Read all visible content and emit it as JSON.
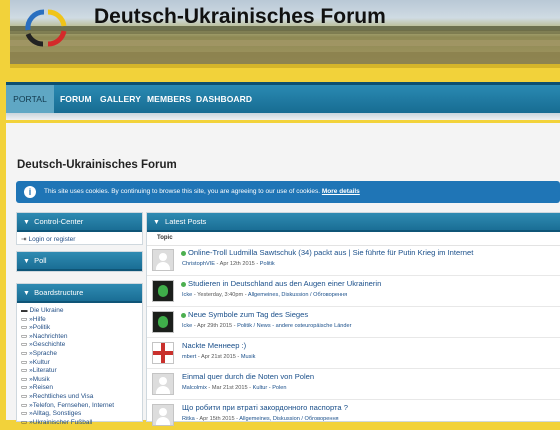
{
  "site": {
    "title": "Deutsch-Ukrainisches Forum"
  },
  "colors": {
    "page_bg": "#f2d23a",
    "nav": "#1f7aa5",
    "notice": "#1f75b6",
    "online": "#4caf50"
  },
  "nav": {
    "items": [
      "PORTAL",
      "FORUM",
      "GALLERY",
      "MEMBERS",
      "DASHBOARD"
    ]
  },
  "page": {
    "title": "Deutsch-Ukrainisches Forum"
  },
  "notice": {
    "text": "This site uses cookies. By continuing to browse this site, you are agreeing to our use of cookies.",
    "link": "More details",
    "icon": "info-icon"
  },
  "sidebar": {
    "control_center": {
      "title": "Control-Center",
      "login": "Login or register"
    },
    "poll": {
      "title": "Poll"
    },
    "boards": {
      "title": "Boardstructure",
      "items": [
        "Die Ukraine",
        "»Hilfe",
        "»Politik",
        "»Nachrichten",
        "»Geschichte",
        "»Sprache",
        "»Kultur",
        "»Literatur",
        "»Musik",
        "»Reisen",
        "»Rechtliches und Visa",
        "»Telefon, Fernsehen, Internet",
        "»Alltag, Sonstiges",
        "»Ukrainischer Fußball"
      ]
    }
  },
  "latest": {
    "title": "Latest Posts",
    "column": "Topic",
    "posts": [
      {
        "title": "Online-Troll Ludmilla Sawtschuk (34) packt aus | Sie führte für Putin Krieg im Internet",
        "user": "ChristophVIE",
        "date": "Apr 12th 2015",
        "category": "Politik",
        "avatar": "default"
      },
      {
        "title": "Studieren in Deutschland aus den Augen einer Ukrainerin",
        "user": "Icke",
        "date": "Yesterday, 3:40pm",
        "category": "Allgemeines, Diskussion / Обговорення",
        "avatar": "dark"
      },
      {
        "title": "Neue Symbole zum Tag des Sieges",
        "user": "Icke",
        "date": "Apr 29th 2015",
        "category": "Politik / News - andere osteuropäische Länder",
        "avatar": "dark"
      },
      {
        "title": "Nackte Меннеер :)",
        "user": "mbert",
        "date": "Apr 21st 2015",
        "category": "Musik",
        "avatar": "flag"
      },
      {
        "title": "Einmal quer durch die Noten von Polen",
        "user": "Malcolmix",
        "date": "Mar 21st 2015",
        "category": "Kultur - Polen",
        "avatar": "default"
      },
      {
        "title": "Що робити при втраті закордонного паспорта ?",
        "user": "Ritka",
        "date": "Apr 15th 2015",
        "category": "Allgemeines, Diskussion / Обговорення",
        "avatar": "default"
      }
    ]
  }
}
